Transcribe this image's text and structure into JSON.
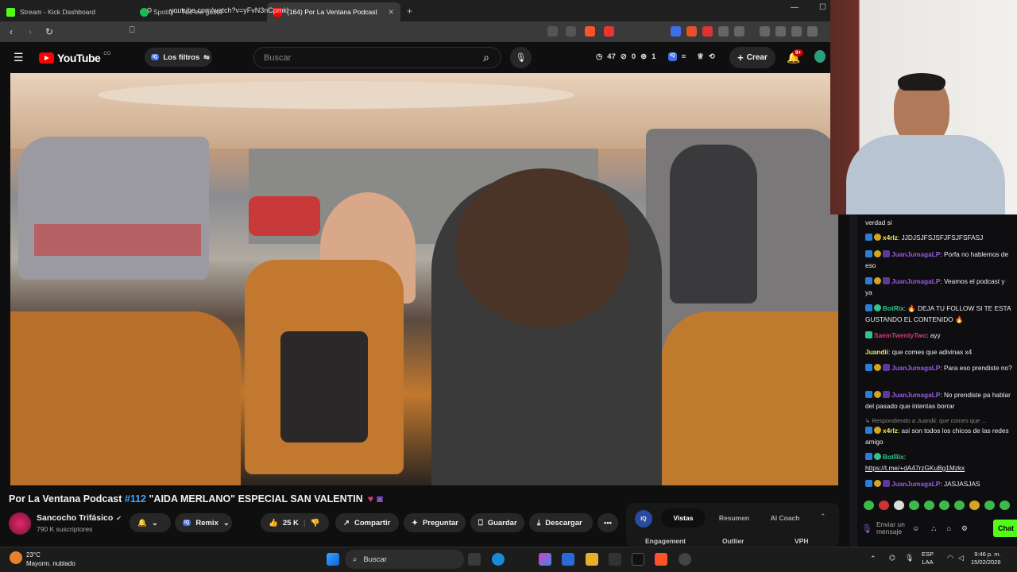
{
  "tabs": [
    {
      "title": "Stream - Kick Dashboard",
      "color": "#53fc18"
    },
    {
      "title": "Spotify – Tus me gusta",
      "color": "#1db954"
    },
    {
      "title": "(164) Por La Ventana Podcast",
      "color": "#ff0000"
    }
  ],
  "address": {
    "url": "youtube.com/watch?v=yFvN3nCpmkI"
  },
  "yt": {
    "logo": "YouTube",
    "country": "CO",
    "filters": "Los filtros",
    "search_placeholder": "Buscar",
    "stats": {
      "likes": "47",
      "zero": "0",
      "one": "1"
    },
    "create": "Crear",
    "notif_count": "9+"
  },
  "video": {
    "title_prefix": "Por La Ventana Podcast ",
    "tag": "#112",
    "title_rest": " \"AIDA MERLANO\" ESPECIAL SAN VALENTIN",
    "channel": "Sancocho Trifásico",
    "subs": "790 K suscriptores",
    "remix": "Remix",
    "likes": "25 K",
    "share": "Compartir",
    "ask": "Preguntar",
    "save": "Guardar",
    "download": "Descargar",
    "more": "•••"
  },
  "panel": {
    "tabs": [
      "Vistas",
      "Resumen",
      "AI Coach"
    ],
    "columns": [
      "Engagement",
      "Outlier",
      "VPH"
    ]
  },
  "chat": {
    "messages": [
      {
        "user": "",
        "text": "verdad si"
      },
      {
        "user": "x4rlz",
        "text": ": JJDJSJFSJSFJFSJFSFASJ",
        "cls": "u5"
      },
      {
        "user": "JuanJumagaLP",
        "text": ": Porfa no hablemos de eso",
        "cls": "u2"
      },
      {
        "user": "JuanJumagaLP",
        "text": ": Veamos el podcast y ya",
        "cls": "u2"
      },
      {
        "user": "BotRix",
        "text": ": 🔥 DEJA TU FOLLOW SI TE ESTA GUSTANDO EL CONTENIDO 🔥",
        "cls": "u3"
      },
      {
        "user": "SaemTwentyTwo",
        "text": ": ayy",
        "cls": "u4"
      },
      {
        "user": "Juandii",
        "text": ": que comes que adivinas x4",
        "cls": "u5"
      },
      {
        "user": "JuanJumagaLP",
        "text": ": Para eso prendiste no?",
        "cls": "u2"
      },
      {
        "user": "JuanJumagaLP",
        "text": ": No prendiste pa hablar del pasado que intentas borrar",
        "cls": "u2"
      },
      {
        "user": "",
        "text": "Respondiendo a Juandii: que comes que ..."
      },
      {
        "user": "x4rlz",
        "text": ": asi son todos los chicos de las redes amigo",
        "cls": "u5"
      },
      {
        "user": "BotRix",
        "text": ":",
        "cls": "u3"
      },
      {
        "user": "",
        "text": "https://t.me/+dA47rzGKuBg1Mzkx"
      },
      {
        "user": "JuanJumagaLP",
        "text": ": JASJASJAS",
        "cls": "u2"
      }
    ],
    "input_placeholder": "Enviar un mensaje",
    "send": "Chat"
  },
  "taskbar": {
    "temp": "23°C",
    "weather": "Mayorm. nublado",
    "search": "Buscar",
    "lang": "ESP",
    "layout": "LAA",
    "time": "9:46 p. m.",
    "date": "15/02/2026"
  }
}
